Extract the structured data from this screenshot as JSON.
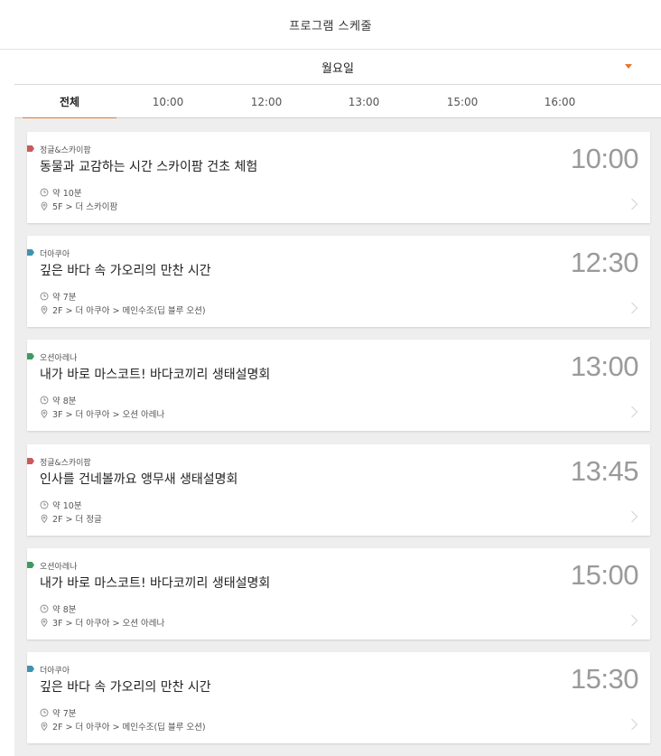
{
  "header": {
    "title": "프로그램 스케줄"
  },
  "day_select": {
    "value": "월요일"
  },
  "tabs": [
    {
      "label": "전체",
      "active": true
    },
    {
      "label": "10:00",
      "active": false
    },
    {
      "label": "12:00",
      "active": false
    },
    {
      "label": "13:00",
      "active": false
    },
    {
      "label": "15:00",
      "active": false
    },
    {
      "label": "16:00",
      "active": false
    }
  ],
  "colors": {
    "accent": "#e8732c",
    "jungle": "#c95a5a",
    "aqua": "#3f93b0",
    "ocean": "#3f9a62"
  },
  "programs": [
    {
      "category": "정글&스카이팜",
      "category_color": "#c95a5a",
      "title": "동물과 교감하는 시간 스카이팜 건초 체험",
      "time": "10:00",
      "duration": "약 10분",
      "location": "5F > 더 스카이팜"
    },
    {
      "category": "더아쿠아",
      "category_color": "#3f93b0",
      "title": "깊은 바다 속 가오리의 만찬 시간",
      "time": "12:30",
      "duration": "약 7분",
      "location": "2F > 더 아쿠아 > 메인수조(딥 블루 오션)"
    },
    {
      "category": "오션아레나",
      "category_color": "#3f9a62",
      "title": "내가 바로 마스코트! 바다코끼리 생태설명회",
      "time": "13:00",
      "duration": "약 8분",
      "location": "3F > 더 아쿠아 > 오션 아레나"
    },
    {
      "category": "정글&스카이팜",
      "category_color": "#c95a5a",
      "title": "인사를 건네볼까요 앵무새 생태설명회",
      "time": "13:45",
      "duration": "약 10분",
      "location": "2F > 더 정글"
    },
    {
      "category": "오션아레나",
      "category_color": "#3f9a62",
      "title": "내가 바로 마스코트! 바다코끼리 생태설명회",
      "time": "15:00",
      "duration": "약 8분",
      "location": "3F > 더 아쿠아 > 오션 아레나"
    },
    {
      "category": "더아쿠아",
      "category_color": "#3f93b0",
      "title": "깊은 바다 속 가오리의 만찬 시간",
      "time": "15:30",
      "duration": "약 7분",
      "location": "2F > 더 아쿠아 > 메인수조(딥 블루 오션)"
    }
  ]
}
